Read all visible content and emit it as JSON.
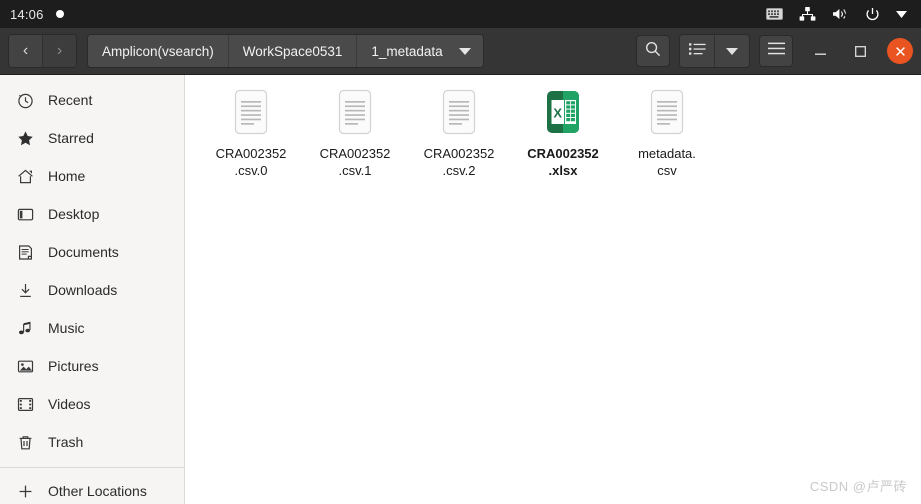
{
  "topbar": {
    "clock": "14:06",
    "notification_indicator": "dot",
    "tray": [
      {
        "name": "keyboard-icon",
        "label": "keyboard"
      },
      {
        "name": "network-icon",
        "label": "network"
      },
      {
        "name": "volume-muted-icon",
        "label": "volume"
      },
      {
        "name": "power-icon",
        "label": "power"
      },
      {
        "name": "chevron-down-icon",
        "label": "system menu"
      }
    ]
  },
  "headerbar": {
    "back_label": "‹",
    "forward_label": "›",
    "breadcrumbs": [
      {
        "label": "Amplicon(vsearch)",
        "current": false
      },
      {
        "label": "WorkSpace0531",
        "current": false
      },
      {
        "label": "1_metadata",
        "current": true
      }
    ],
    "search_label": "Search",
    "view_list_label": "List view",
    "view_dropdown_label": "View options",
    "menu_label": "Main menu",
    "minimize_label": "–",
    "maximize_label": "□",
    "close_label": "✕",
    "accent_color": "#e95420"
  },
  "sidebar": {
    "items": [
      {
        "label": "Recent",
        "icon": "clock-icon"
      },
      {
        "label": "Starred",
        "icon": "star-icon"
      },
      {
        "label": "Home",
        "icon": "home-icon"
      },
      {
        "label": "Desktop",
        "icon": "desktop-icon"
      },
      {
        "label": "Documents",
        "icon": "documents-icon"
      },
      {
        "label": "Downloads",
        "icon": "downloads-icon"
      },
      {
        "label": "Music",
        "icon": "music-icon"
      },
      {
        "label": "Pictures",
        "icon": "pictures-icon"
      },
      {
        "label": "Videos",
        "icon": "videos-icon"
      },
      {
        "label": "Trash",
        "icon": "trash-icon"
      }
    ],
    "other_locations": {
      "label": "Other Locations",
      "icon": "plus-icon"
    }
  },
  "files": [
    {
      "name": "CRA002352.csv.0",
      "line1": "CRA002352",
      "line2": ".csv.0",
      "type": "text",
      "selected": false
    },
    {
      "name": "CRA002352.csv.1",
      "line1": "CRA002352",
      "line2": ".csv.1",
      "type": "text",
      "selected": false
    },
    {
      "name": "CRA002352.csv.2",
      "line1": "CRA002352",
      "line2": ".csv.2",
      "type": "text",
      "selected": false
    },
    {
      "name": "CRA002352.xlsx",
      "line1": "CRA002352",
      "line2": ".xlsx",
      "type": "spreadsheet",
      "selected": true
    },
    {
      "name": "metadata.csv",
      "line1": "metadata.",
      "line2": "csv",
      "type": "text",
      "selected": false
    }
  ],
  "watermark": "CSDN @卢严砖"
}
